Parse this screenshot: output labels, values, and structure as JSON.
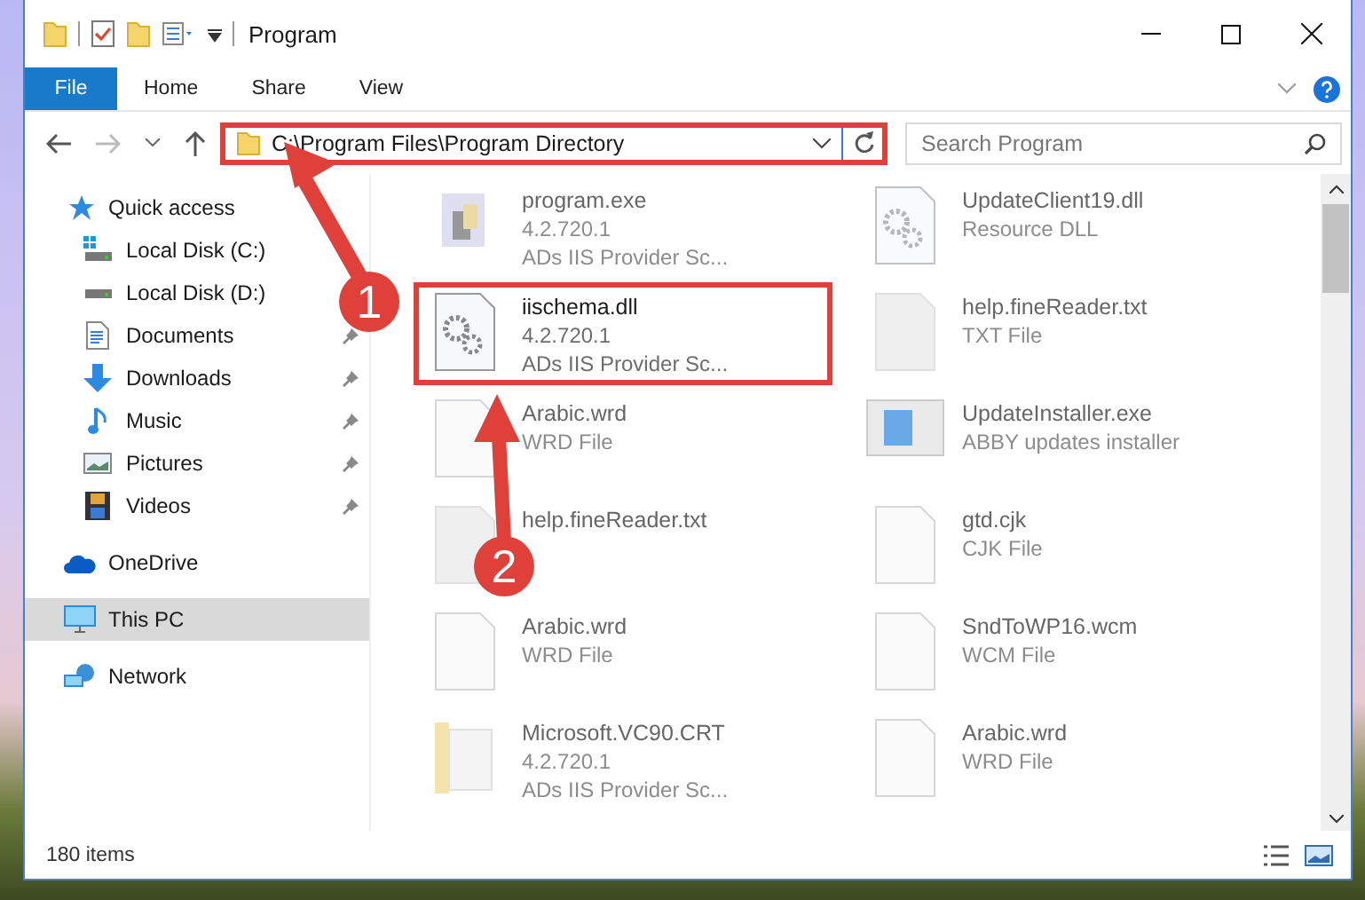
{
  "window": {
    "title": "Program"
  },
  "ribbon": {
    "tabs": [
      {
        "label": "File",
        "kind": "file"
      },
      {
        "label": "Home",
        "kind": "tab"
      },
      {
        "label": "Share",
        "kind": "tab"
      },
      {
        "label": "View",
        "kind": "tab"
      }
    ]
  },
  "address_bar": {
    "path": "C:\\Program Files\\Program Directory",
    "highlighted": true
  },
  "search": {
    "placeholder": "Search Program"
  },
  "sidebar": {
    "items": [
      {
        "label": "Quick access",
        "kind": "quick",
        "selected": false,
        "children": [
          {
            "label": "Local Disk (C:)",
            "kind": "system-drive",
            "pinned": false
          },
          {
            "label": "Local Disk (D:)",
            "kind": "drive",
            "pinned": false
          },
          {
            "label": "Documents",
            "kind": "documents",
            "pinned": true
          },
          {
            "label": "Downloads",
            "kind": "downloads",
            "pinned": true
          },
          {
            "label": "Music",
            "kind": "music",
            "pinned": true
          },
          {
            "label": "Pictures",
            "kind": "pictures",
            "pinned": true
          },
          {
            "label": "Videos",
            "kind": "videos",
            "pinned": true
          }
        ]
      },
      {
        "label": "OneDrive",
        "kind": "cloud",
        "selected": false
      },
      {
        "label": "This PC",
        "kind": "pc",
        "selected": true
      },
      {
        "label": "Network",
        "kind": "network",
        "selected": false
      }
    ]
  },
  "files": [
    {
      "name": "program.exe",
      "details": [
        "4.2.720.1",
        "ADs IIS Provider Sc..."
      ],
      "kind": "exe",
      "highlighted": false
    },
    {
      "name": "UpdateClient19.dll",
      "details": [
        "Resource DLL"
      ],
      "kind": "dll",
      "highlighted": false
    },
    {
      "name": "iischema.dll",
      "details": [
        "4.2.720.1",
        "ADs IIS Provider Sc..."
      ],
      "kind": "dll",
      "highlighted": true
    },
    {
      "name": "help.fineReader.txt",
      "details": [
        "TXT File"
      ],
      "kind": "grey",
      "highlighted": false
    },
    {
      "name": "Arabic.wrd",
      "details": [
        "WRD File"
      ],
      "kind": "blank",
      "highlighted": false
    },
    {
      "name": "UpdateInstaller.exe",
      "details": [
        "ABBY updates installer"
      ],
      "kind": "installer",
      "highlighted": false
    },
    {
      "name": "help.fineReader.txt",
      "kind": "grey",
      "highlighted": false
    },
    {
      "name": "gtd.cjk",
      "details": [
        "CJK File"
      ],
      "kind": "blank",
      "highlighted": false
    },
    {
      "name": "Arabic.wrd",
      "details": [
        "WRD File"
      ],
      "kind": "blank",
      "highlighted": false
    },
    {
      "name": "SndToWP16.wcm",
      "details": [
        "WCM File"
      ],
      "kind": "blank",
      "highlighted": false
    },
    {
      "name": "Microsoft.VC90.CRT",
      "details": [
        "4.2.720.1",
        "ADs IIS Provider Sc..."
      ],
      "kind": "folder",
      "highlighted": false
    },
    {
      "name": "Arabic.wrd",
      "details": [
        "WRD File"
      ],
      "kind": "blank",
      "highlighted": false
    }
  ],
  "status_bar": {
    "count": "180 items"
  },
  "annotations": [
    {
      "number": "1"
    },
    {
      "number": "2"
    }
  ]
}
